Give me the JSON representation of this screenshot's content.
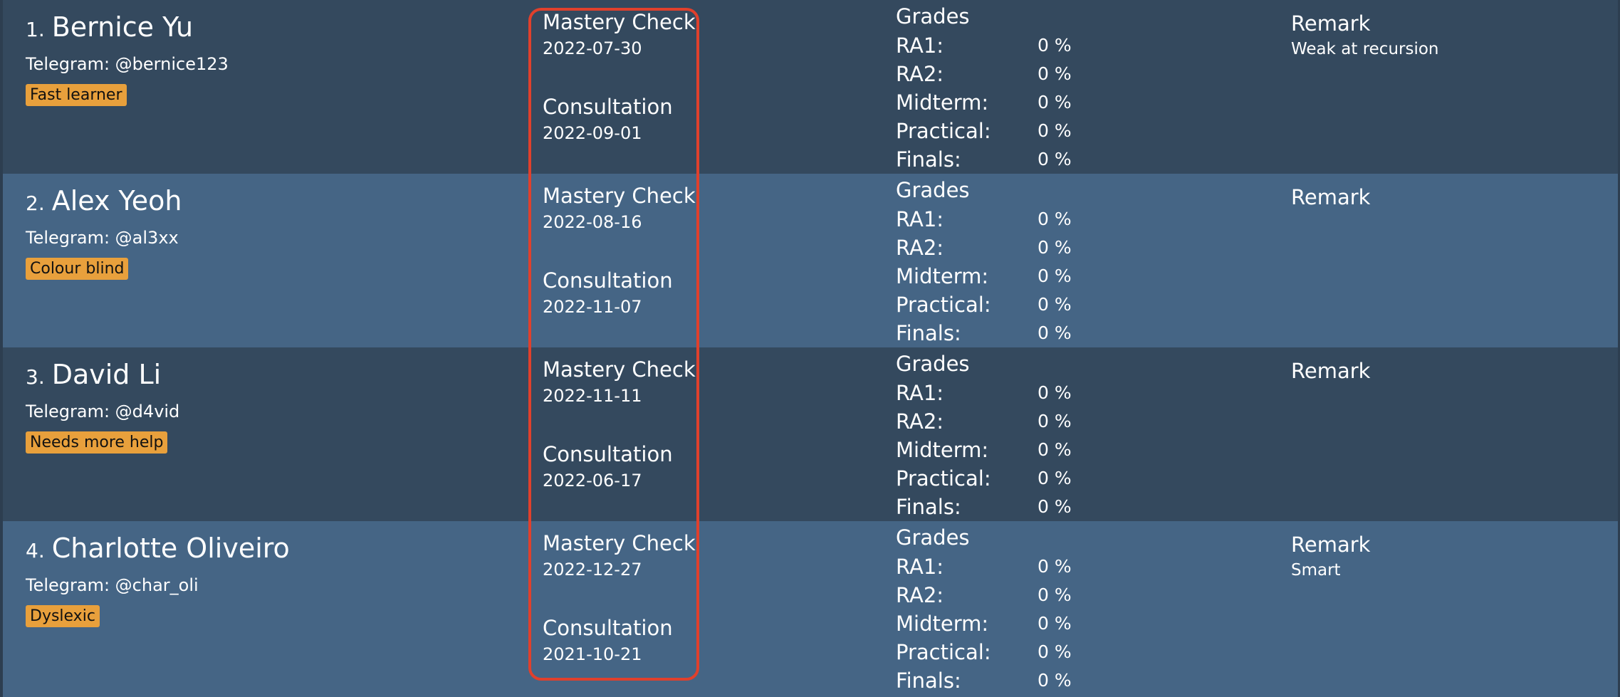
{
  "persons": [
    {
      "index": "1.",
      "name": "Bernice Yu",
      "telegram": "Telegram: @bernice123",
      "tag": "Fast learner",
      "mastery_label": "Mastery Check",
      "mastery_date": "2022-07-30",
      "consultation_label": "Consultation",
      "consultation_date": "2022-09-01",
      "grades_title": "Grades",
      "grades": [
        {
          "label": "RA1:",
          "value": "0 %"
        },
        {
          "label": "RA2:",
          "value": "0 %"
        },
        {
          "label": "Midterm:",
          "value": "0 %"
        },
        {
          "label": "Practical:",
          "value": "0 %"
        },
        {
          "label": "Finals:",
          "value": "0 %"
        }
      ],
      "remark_title": "Remark",
      "remark": "Weak at recursion"
    },
    {
      "index": "2.",
      "name": "Alex Yeoh",
      "telegram": "Telegram: @al3xx",
      "tag": "Colour blind",
      "mastery_label": "Mastery Check",
      "mastery_date": "2022-08-16",
      "consultation_label": "Consultation",
      "consultation_date": "2022-11-07",
      "grades_title": "Grades",
      "grades": [
        {
          "label": "RA1:",
          "value": "0 %"
        },
        {
          "label": "RA2:",
          "value": "0 %"
        },
        {
          "label": "Midterm:",
          "value": "0 %"
        },
        {
          "label": "Practical:",
          "value": "0 %"
        },
        {
          "label": "Finals:",
          "value": "0 %"
        }
      ],
      "remark_title": "Remark",
      "remark": ""
    },
    {
      "index": "3.",
      "name": "David Li",
      "telegram": "Telegram: @d4vid",
      "tag": "Needs more help",
      "mastery_label": "Mastery Check",
      "mastery_date": "2022-11-11",
      "consultation_label": "Consultation",
      "consultation_date": "2022-06-17",
      "grades_title": "Grades",
      "grades": [
        {
          "label": "RA1:",
          "value": "0 %"
        },
        {
          "label": "RA2:",
          "value": "0 %"
        },
        {
          "label": "Midterm:",
          "value": "0 %"
        },
        {
          "label": "Practical:",
          "value": "0 %"
        },
        {
          "label": "Finals:",
          "value": "0 %"
        }
      ],
      "remark_title": "Remark",
      "remark": ""
    },
    {
      "index": "4.",
      "name": "Charlotte Oliveiro",
      "telegram": "Telegram: @char_oli",
      "tag": "Dyslexic",
      "mastery_label": "Mastery Check",
      "mastery_date": "2022-12-27",
      "consultation_label": "Consultation",
      "consultation_date": "2021-10-21",
      "grades_title": "Grades",
      "grades": [
        {
          "label": "RA1:",
          "value": "0 %"
        },
        {
          "label": "RA2:",
          "value": "0 %"
        },
        {
          "label": "Midterm:",
          "value": "0 %"
        },
        {
          "label": "Practical:",
          "value": "0 %"
        },
        {
          "label": "Finals:",
          "value": "0 %"
        }
      ],
      "remark_title": "Remark",
      "remark": "Smart"
    }
  ],
  "colors": {
    "background": "#2d3e50",
    "row_dark": "#34495e",
    "row_light": "#456585",
    "tag_bg": "#e8a03c",
    "highlight_border": "#e0402c"
  }
}
